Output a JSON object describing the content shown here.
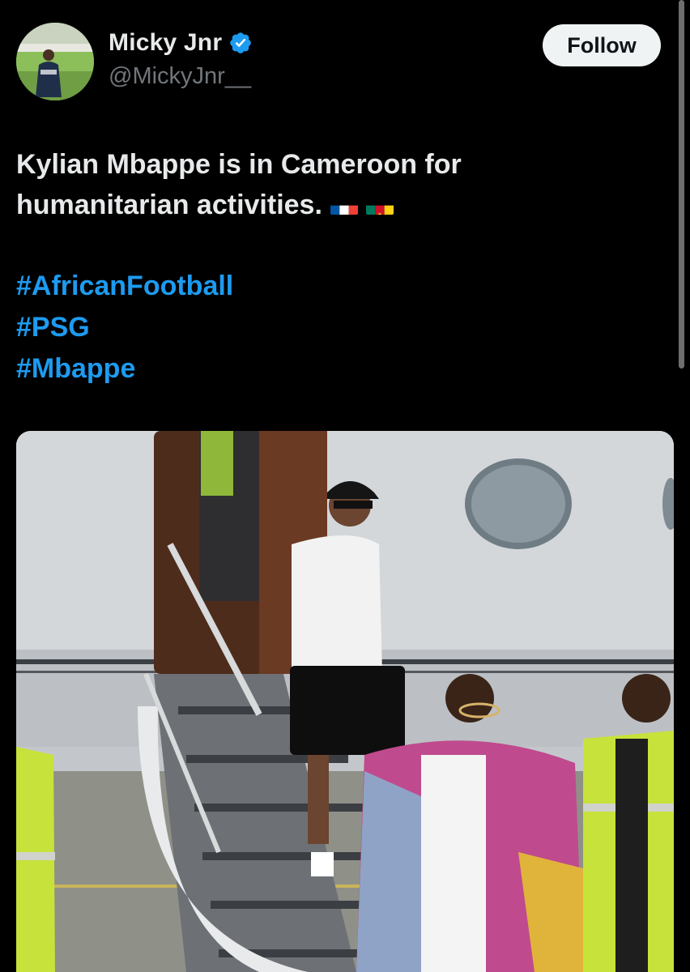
{
  "author": {
    "display_name": "Micky Jnr",
    "handle": "@MickyJnr__",
    "verified_icon": "verified-badge-icon",
    "avatar_icon": "avatar-photo"
  },
  "follow_button": {
    "label": "Follow"
  },
  "tweet": {
    "text_line1": "Kylian Mbappe is in Cameroon for",
    "text_line2": "humanitarian activities.",
    "flags": [
      "flag-france",
      "flag-cameroon"
    ],
    "hashtags": [
      "#AfricanFootball",
      "#PSG",
      "#Mbappe"
    ]
  },
  "media": {
    "image_icon": "photo-mbappe-descending-jet-stairs"
  },
  "colors": {
    "background": "#000000",
    "text": "#e7e9ea",
    "secondary": "#71767b",
    "accent": "#1d9bf0",
    "verified": "#1d9bf0",
    "follow_bg": "#eff3f4"
  }
}
